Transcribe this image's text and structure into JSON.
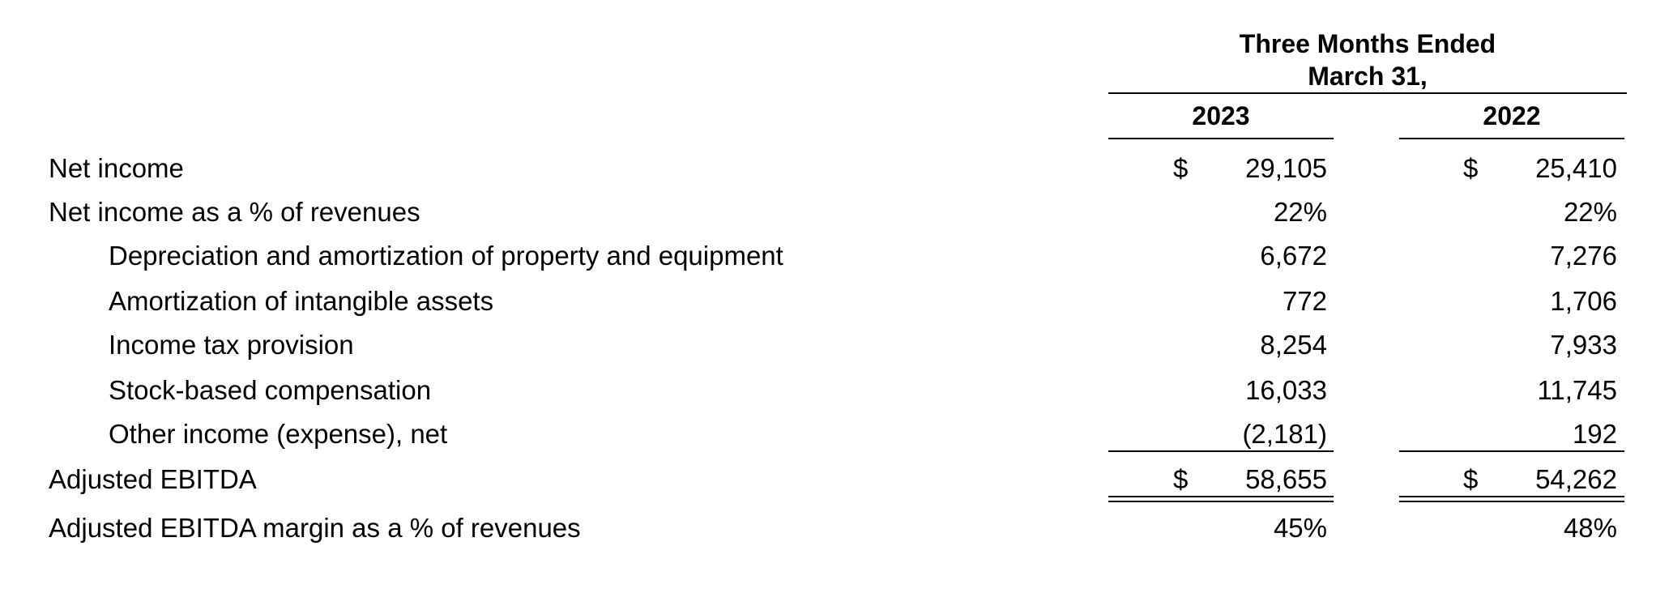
{
  "header": {
    "period_line1": "Three Months Ended",
    "period_line2": "March 31,",
    "year1": "2023",
    "year2": "2022"
  },
  "rows": [
    {
      "label": "Net income",
      "cur1": "$",
      "v1": "29,105",
      "cur2": "$",
      "v2": "25,410"
    },
    {
      "label": "Net income as a % of revenues",
      "v1": "22%",
      "v2": "22%"
    },
    {
      "label": "Depreciation and amortization of property and equipment",
      "v1": "6,672",
      "v2": "7,276"
    },
    {
      "label": "Amortization of intangible assets",
      "v1": "772",
      "v2": "1,706"
    },
    {
      "label": "Income tax provision",
      "v1": "8,254",
      "v2": "7,933"
    },
    {
      "label": "Stock-based compensation",
      "v1": "16,033",
      "v2": "11,745"
    },
    {
      "label": "Other income (expense), net",
      "v1": "(2,181)",
      "v2": "192"
    },
    {
      "label": "Adjusted EBITDA",
      "cur1": "$",
      "v1": "58,655",
      "cur2": "$",
      "v2": "54,262"
    },
    {
      "label": "Adjusted EBITDA margin as a % of revenues",
      "v1": "45%",
      "v2": "48%"
    }
  ]
}
